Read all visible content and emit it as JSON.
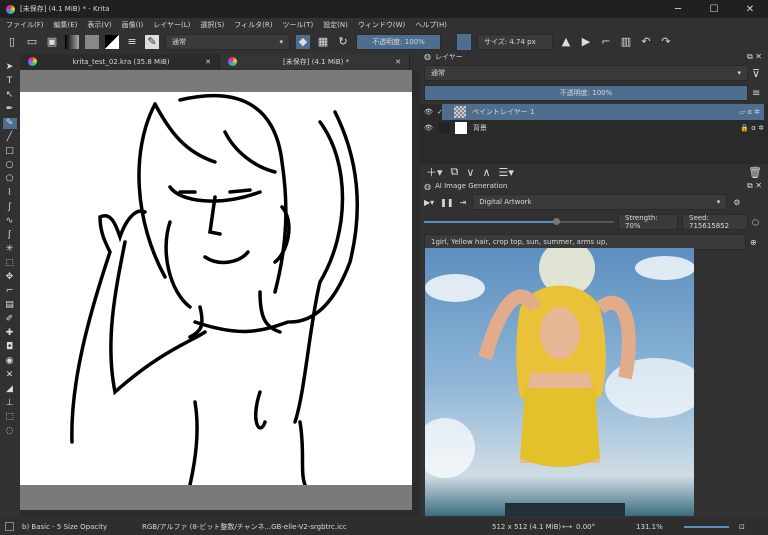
{
  "window": {
    "title": "[未保存]  (4.1 MiB) * - Krita",
    "minimize": "─",
    "maximize": "☐",
    "close": "✕"
  },
  "menu": [
    "ファイル(F)",
    "編集(E)",
    "表示(V)",
    "画像(I)",
    "レイヤー(L)",
    "選択(S)",
    "フィルタ(R)",
    "ツール(T)",
    "設定(N)",
    "ウィンドウ(W)",
    "ヘルプ(H)"
  ],
  "toolbar": {
    "blend_mode": "通常",
    "opacity": "不透明度: 100%",
    "size": "サイズ: 4.74 px",
    "accent": "#4d6e8e"
  },
  "tabs": [
    {
      "label": "krita_test_02.kra (35.8 MiB)",
      "close": "✕"
    },
    {
      "label": "[未保存]  (4.1 MiB) *",
      "close": "✕"
    }
  ],
  "layers_docker": {
    "title": "レイヤー",
    "blend_mode": "通常",
    "opacity": "不透明度: 100%",
    "layers": [
      {
        "name": "ペイントレイヤー 1",
        "selected": true,
        "visible": true
      },
      {
        "name": "背景",
        "selected": false,
        "visible": true,
        "locked": true
      }
    ]
  },
  "ai_docker": {
    "title": "AI Image Generation",
    "style": "Digital Artwork",
    "strength": "Strength: 70%",
    "seed": "Seed: 715615852",
    "prompt": "1girl, Yellow hair, crop top, sun, summer, arms up,",
    "strength_value": 70
  },
  "status": {
    "brush": "b) Basic - 5 Size Opacity",
    "color_space": "RGB/アルファ (8-ビット整数/チャンネ...GB-elle-V2-srgbtrc.icc",
    "dimensions": "512 x 512 (4.1 MiB)",
    "rotation": "0.00°",
    "zoom": "131.1%"
  }
}
